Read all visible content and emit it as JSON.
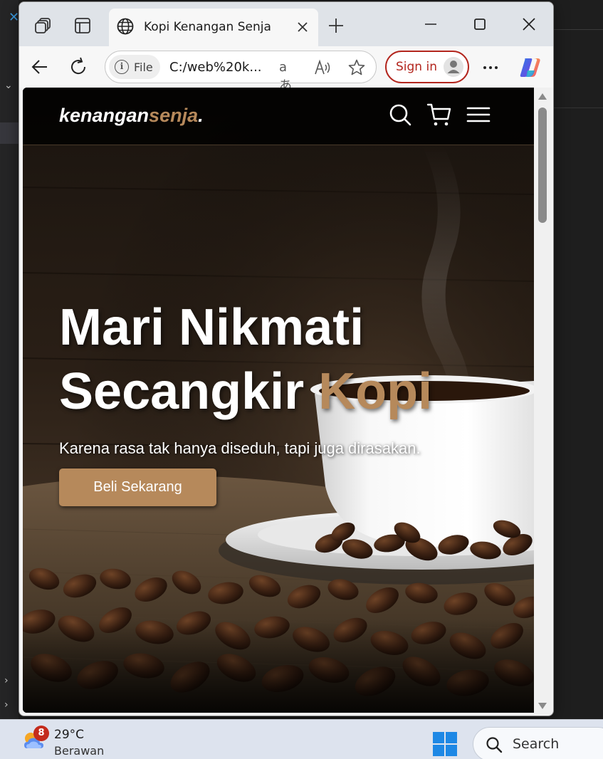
{
  "browser": {
    "tab_title": "Kopi Kenangan Senja",
    "address": {
      "scheme_label": "File",
      "url": "C:/web%20k..."
    },
    "sign_in_label": "Sign in"
  },
  "site": {
    "logo": {
      "part1": "kenangan",
      "part2": "senja",
      "part3": "."
    },
    "hero": {
      "title_line1": "Mari Nikmati",
      "title_line2_prefix": "Secangkir ",
      "title_line2_accent": "Kopi",
      "subtitle": "Karena rasa tak hanya diseduh, tapi juga dirasakan.",
      "cta_label": "Beli Sekarang"
    },
    "colors": {
      "accent": "#b6895b",
      "nav_bg": "#000000",
      "text": "#ffffff"
    }
  },
  "taskbar": {
    "weather": {
      "badge": "8",
      "temp": "29°C",
      "condition": "Berawan"
    },
    "search_label": "Search"
  },
  "icons": {
    "nav": [
      "search-icon",
      "cart-icon",
      "menu-icon"
    ],
    "browser": [
      "workspaces-icon",
      "tab-actions-icon",
      "globe-icon",
      "close-icon",
      "plus-icon",
      "minimize-icon",
      "maximize-icon",
      "back-icon",
      "refresh-icon",
      "info-icon",
      "translate-icon",
      "read-aloud-icon",
      "favorite-icon",
      "profile-icon",
      "more-icon",
      "copilot-icon"
    ]
  }
}
